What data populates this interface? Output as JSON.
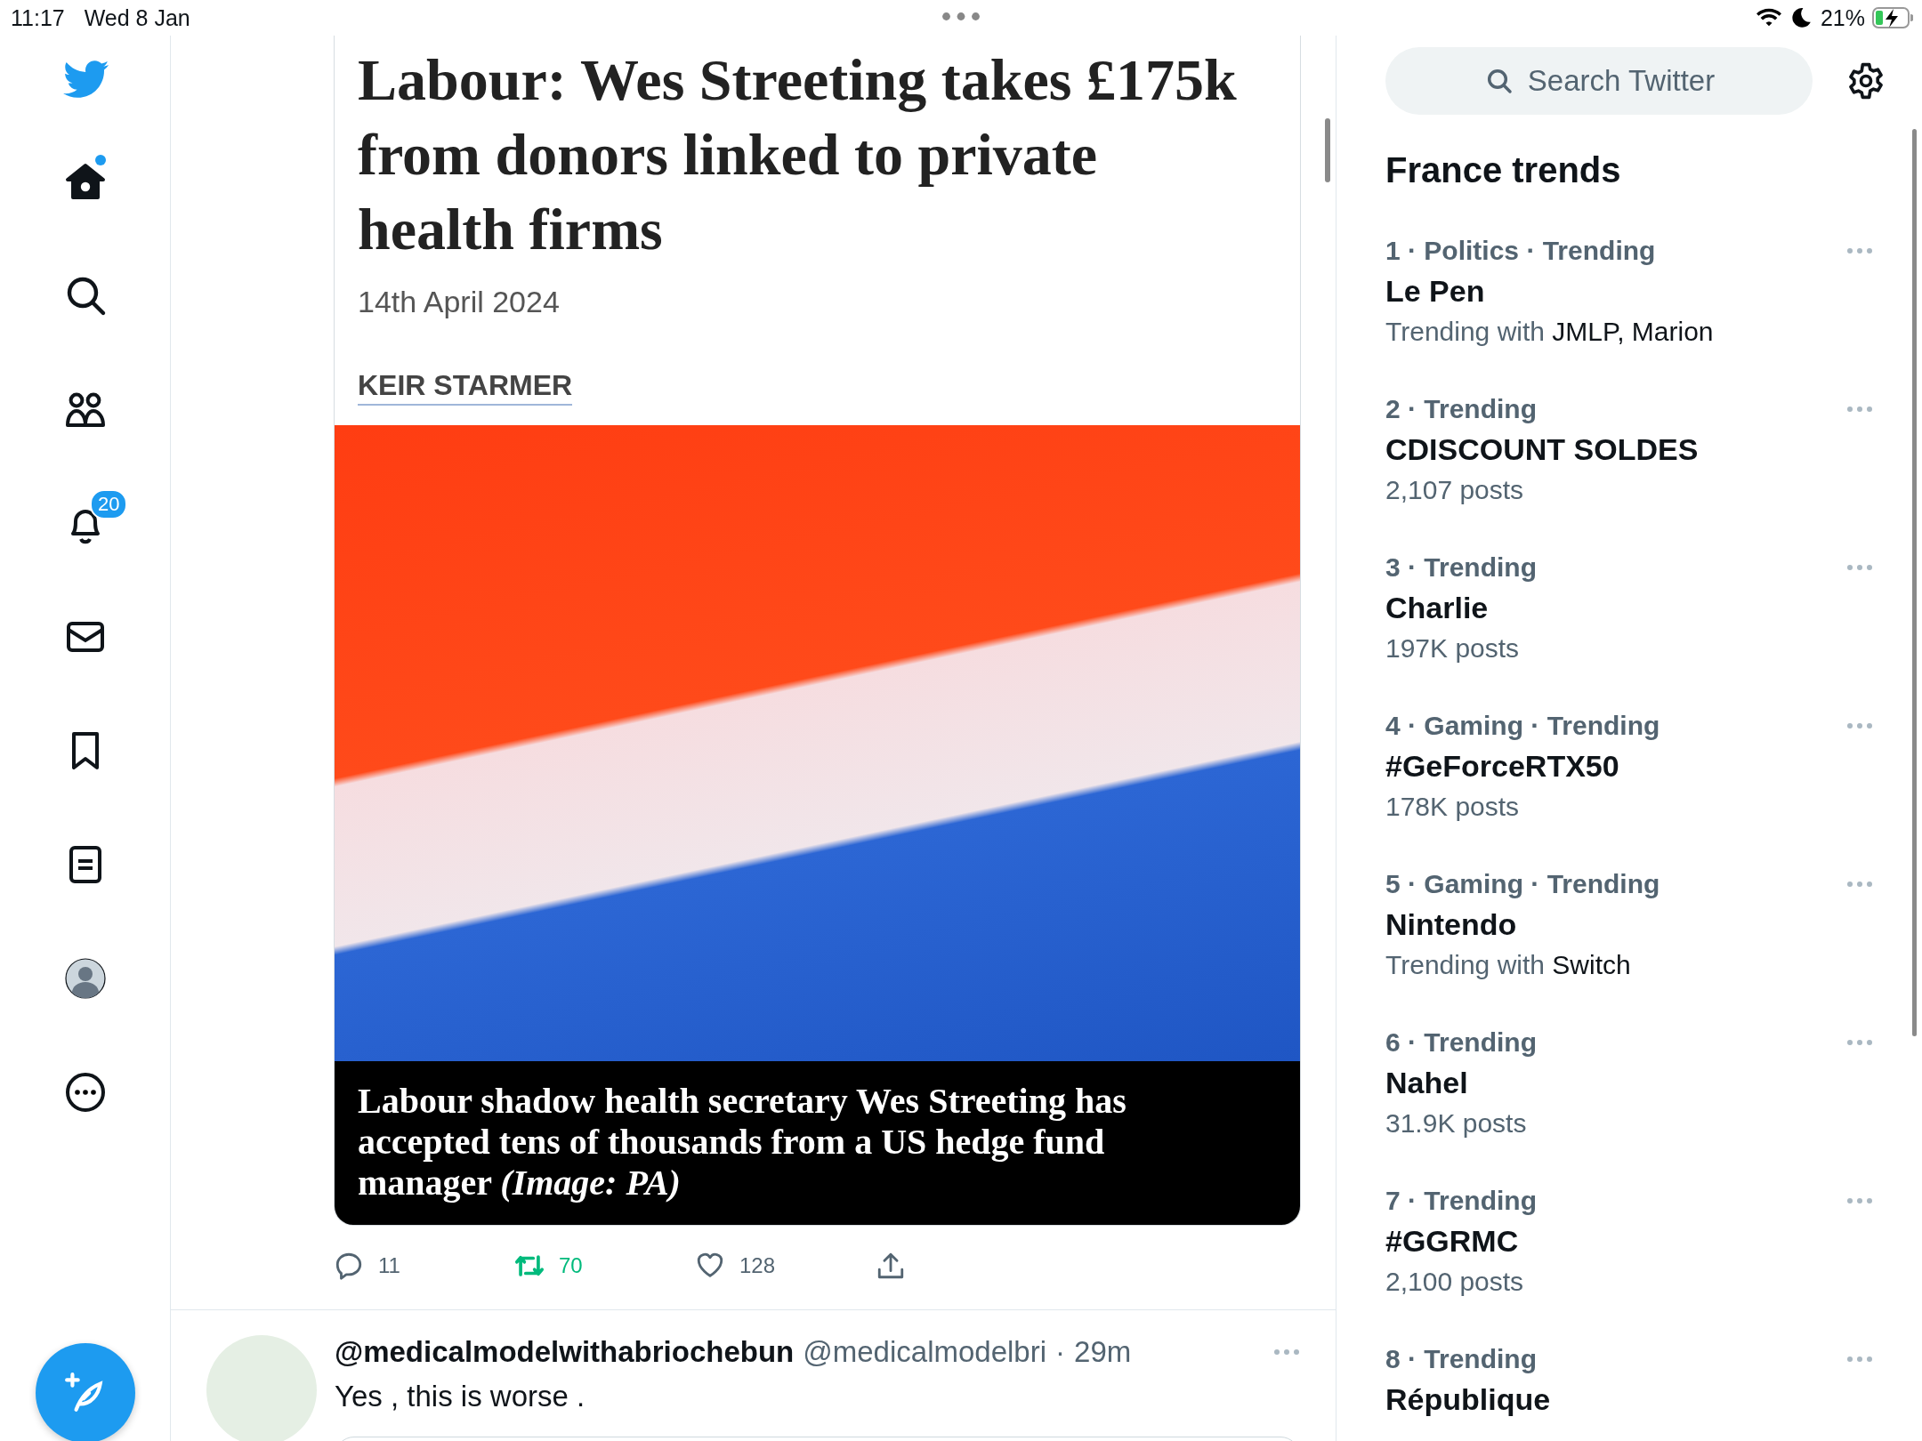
{
  "status_bar": {
    "time": "11:17",
    "date": "Wed 8 Jan",
    "battery": "21%"
  },
  "nav": {
    "items": [
      {
        "kind": "home",
        "selected": true,
        "unread_dot": true
      },
      {
        "kind": "search",
        "selected": false
      },
      {
        "kind": "communities",
        "selected": false
      },
      {
        "kind": "notifications",
        "selected": false,
        "badge": "20"
      },
      {
        "kind": "messages",
        "selected": false
      },
      {
        "kind": "bookmarks",
        "selected": false
      },
      {
        "kind": "lists",
        "selected": false
      },
      {
        "kind": "profile",
        "selected": false
      },
      {
        "kind": "more",
        "selected": false
      }
    ]
  },
  "article": {
    "headline": "Labour: Wes Streeting takes £175k from donors linked to private health firms",
    "date": "14th April 2024",
    "tag": "KEIR STARMER",
    "caption": "Labour shadow health secretary Wes Streeting has accepted tens of thousands from a US hedge fund manager *(Image: PA)*"
  },
  "actions": [
    {
      "kind": "reply",
      "count": "11",
      "active": false
    },
    {
      "kind": "retweet",
      "count": "70",
      "active": true
    },
    {
      "kind": "like",
      "count": "128",
      "active": false
    },
    {
      "kind": "share",
      "active": false
    }
  ],
  "reply_tweet": {
    "name": "@medicalmodelwithabriochebun",
    "handle": "@medicalmodelbri",
    "separator": "·",
    "time": "29m",
    "text": "Yes , this is worse ."
  },
  "search": {
    "placeholder": "Search Twitter"
  },
  "trends": {
    "title": "France trends",
    "items": [
      {
        "meta": "1 · Politics · Trending",
        "name": "Le Pen",
        "lead": "Trending with",
        "related": "JMLP, Marion"
      },
      {
        "meta": "2 · Trending",
        "name": "CDISCOUNT SOLDES",
        "posts": "2,107 posts"
      },
      {
        "meta": "3 · Trending",
        "name": "Charlie",
        "posts": "197K posts"
      },
      {
        "meta": "4 · Gaming · Trending",
        "name": "#GeForceRTX50",
        "posts": "178K posts"
      },
      {
        "meta": "5 · Gaming · Trending",
        "name": "Nintendo",
        "lead": "Trending with",
        "related": "Switch"
      },
      {
        "meta": "6 · Trending",
        "name": "Nahel",
        "posts": "31.9K posts"
      },
      {
        "meta": "7 · Trending",
        "name": "#GGRMC",
        "posts": "2,100 posts"
      },
      {
        "meta": "8 · Trending",
        "name": "République"
      }
    ]
  }
}
